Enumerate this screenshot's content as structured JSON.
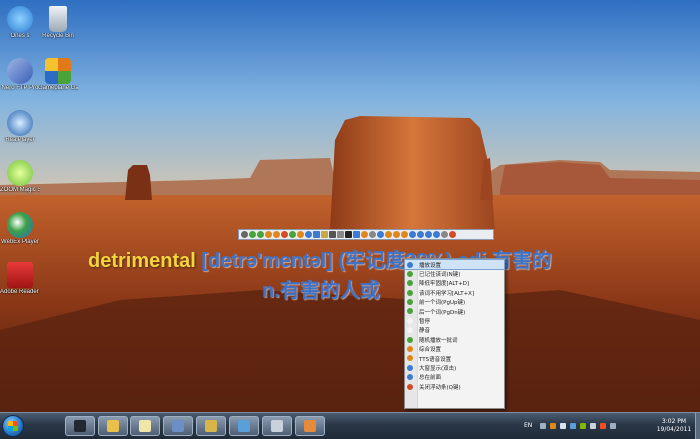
{
  "desktop": {
    "icons": [
      {
        "label": "Ones s",
        "icon": "windows-live-icon",
        "color": "#2b7fd6"
      },
      {
        "label": "Recycle Bin",
        "icon": "recycle-bin-icon",
        "color": "#c9d3dc"
      },
      {
        "label": "Nero FTP Pro",
        "icon": "ftp-client-icon",
        "color": "#3a5fb5"
      },
      {
        "label": "Gameplane Gameblo...",
        "icon": "game-icon",
        "color": "#e07a18"
      },
      {
        "label": "RealPlayer",
        "icon": "realplayer-icon",
        "color": "#1f5fae"
      },
      {
        "label": "ZOOM Magic Shortcut",
        "icon": "magic-app-icon",
        "color": "#6cc03a"
      },
      {
        "label": "WebEx Player",
        "icon": "webex-player-icon",
        "color": "#3da047"
      },
      {
        "label": "Adobe Reader 9",
        "icon": "adobe-reader-icon",
        "color": "#cc1f1f"
      }
    ]
  },
  "dictionary": {
    "toolbar_icons": [
      "settings-icon",
      "add-icon",
      "play-icon",
      "pause-icon",
      "record-icon",
      "stop-icon",
      "refresh-icon",
      "cancel-icon",
      "list-icon",
      "grid-icon",
      "book-icon",
      "font-icon",
      "lock-icon",
      "square-icon",
      "note-icon",
      "favorite-icon",
      "exit-icon",
      "mail-icon",
      "help-icon",
      "info-icon",
      "warn-icon",
      "prev-icon",
      "zoom-out-icon",
      "zoom-in-icon",
      "search-icon",
      "pin-icon",
      "close-icon"
    ],
    "word": "detrimental",
    "phonetic": "[detrə'mentəl]",
    "memory": "(牢记度20%)",
    "definition_part1": "adj.有害的",
    "definition_part2": "n.有害的人或",
    "word_color": "#f4d33c",
    "text_color": "#3d74c9"
  },
  "context_menu": {
    "items": [
      {
        "label": "播放设置",
        "icon": "settings-icon",
        "color": "#3b7bd4",
        "highlighted": true
      },
      {
        "label": "已记住该词(N键)",
        "icon": "check-icon",
        "color": "#4aa23a"
      },
      {
        "label": "降低牢固度[ALT+D]",
        "icon": "down-icon",
        "color": "#4aa23a"
      },
      {
        "label": "该词不用学习[ALT+X]",
        "icon": "cancel-icon",
        "color": "#4aa23a"
      },
      {
        "label": "前一个词(PgUp键)",
        "icon": "prev-icon",
        "color": "#4aa23a"
      },
      {
        "label": "后一个词(PgDn键)",
        "icon": "next-icon",
        "color": "#4aa23a"
      },
      {
        "label": "暂停",
        "icon": "pause-icon",
        "color": "#f3f3f3"
      },
      {
        "label": "静音",
        "icon": "mute-icon",
        "color": "#f3f3f3"
      },
      {
        "label": "随机播放一批词",
        "icon": "shuffle-icon",
        "color": "#4aa23a"
      },
      {
        "label": "综合设置",
        "icon": "gear-icon",
        "color": "#e0861a"
      },
      {
        "label": "TTS语音设置",
        "icon": "speaker-icon",
        "color": "#e0861a"
      },
      {
        "label": "大窗显示(双击)",
        "icon": "window-icon",
        "color": "#3b7bd4"
      },
      {
        "label": "总在前面",
        "icon": "checkmark-icon",
        "color": "#3b7bd4"
      },
      {
        "label": "关闭浮动条(Q键)",
        "icon": "close-icon",
        "color": "#d24a2a"
      }
    ]
  },
  "taskbar": {
    "buttons": [
      {
        "name": "taskbar-terminal",
        "icon": "terminal-icon",
        "color": "#222831"
      },
      {
        "name": "taskbar-explorer",
        "icon": "folder-icon",
        "color": "#e8c04a"
      },
      {
        "name": "taskbar-notes",
        "icon": "notes-icon",
        "color": "#f1e6a8"
      },
      {
        "name": "taskbar-app",
        "icon": "app-icon",
        "color": "#6a8fc7"
      },
      {
        "name": "taskbar-archive",
        "icon": "archive-icon",
        "color": "#d8b54a"
      },
      {
        "name": "taskbar-monitor",
        "icon": "monitor-icon",
        "color": "#5aa0d8"
      },
      {
        "name": "taskbar-tool",
        "icon": "tool-icon",
        "color": "#c9d2dc"
      },
      {
        "name": "taskbar-dictionary",
        "icon": "dictionary-icon",
        "color": "#e58a3a"
      }
    ],
    "language": "EN",
    "time": "3:02 PM",
    "date": "19/04/2011"
  }
}
